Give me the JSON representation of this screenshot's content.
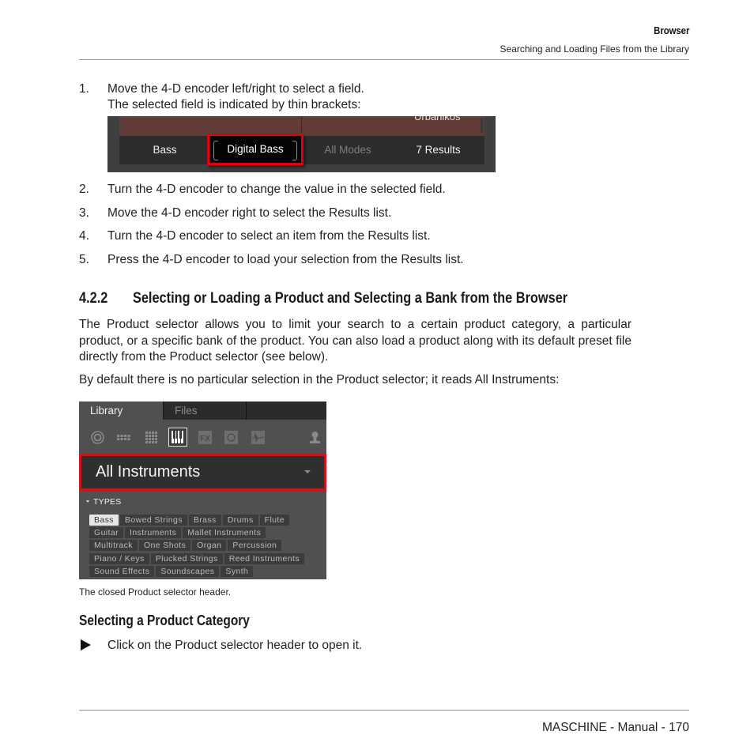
{
  "header": {
    "section": "Browser",
    "subsection": "Searching and Loading Files from the Library"
  },
  "steps_a": [
    {
      "num": "1.",
      "line1": "Move the 4-D encoder left/right to select a field.",
      "line2": "The selected field is indicated by thin brackets:"
    }
  ],
  "figure1": {
    "partial_row_text": "Urbanikos",
    "fields": [
      {
        "label": "Bass",
        "state": "normal"
      },
      {
        "label": "Digital Bass",
        "state": "selected"
      },
      {
        "label": "All Modes",
        "state": "dimmed"
      },
      {
        "label": "7 Results",
        "state": "normal"
      }
    ],
    "highlight_color": "#e0000f"
  },
  "steps_b": [
    {
      "num": "2.",
      "text": "Turn the 4-D encoder to change the value in the selected field."
    },
    {
      "num": "3.",
      "text": "Move the 4-D encoder right to select the Results list."
    },
    {
      "num": "4.",
      "text": "Turn the 4-D encoder to select an item from the Results list."
    },
    {
      "num": "5.",
      "text": "Press the 4-D encoder to load your selection from the Results list."
    }
  ],
  "section": {
    "number": "4.2.2",
    "title": "Selecting or Loading a Product and Selecting a Bank from the Browser",
    "para1": "The Product selector allows you to limit your search to a certain product category, a particular product, or a specific bank of the product. You can also load a product along with its default preset file directly from the Product selector (see below).",
    "para2": "By default there is no particular selection in the Product selector; it reads All Instruments:"
  },
  "figure2": {
    "tabs": [
      {
        "label": "Library",
        "active": true
      },
      {
        "label": "Files",
        "active": false
      }
    ],
    "icons": [
      "all-files-icon",
      "group-icon",
      "sound-icon",
      "instrument-icon",
      "effect-icon",
      "loop-icon",
      "sample-icon",
      "user-icon"
    ],
    "selected_icon": "instrument-icon",
    "product_selector": "All Instruments",
    "types_header": "TYPES",
    "type_rows": [
      [
        "Bass",
        "Bowed Strings",
        "Brass",
        "Drums",
        "Flute"
      ],
      [
        "Guitar",
        "Instruments",
        "Mallet Instruments"
      ],
      [
        "Multitrack",
        "One Shots",
        "Organ",
        "Percussion"
      ],
      [
        "Piano / Keys",
        "Plucked Strings",
        "Reed Instruments"
      ],
      [
        "Sound Effects",
        "Soundscapes",
        "Synth"
      ]
    ],
    "selected_type": "Bass",
    "highlight_color": "#c8161b",
    "caption": "The closed Product selector header."
  },
  "subsection": {
    "title": "Selecting a Product Category",
    "bullet": "Click on the Product selector header to open it."
  },
  "footer": {
    "text": "MASCHINE - Manual - 170"
  }
}
